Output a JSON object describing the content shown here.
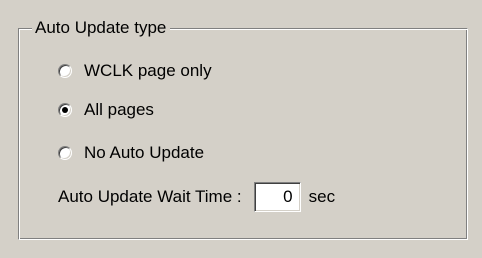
{
  "group": {
    "title": "Auto Update type"
  },
  "options": [
    {
      "label": "WCLK page only",
      "checked": false
    },
    {
      "label": "All pages",
      "checked": true
    },
    {
      "label": "No Auto Update",
      "checked": false
    }
  ],
  "wait_time": {
    "label": "Auto Update Wait Time :",
    "value": "0",
    "unit": "sec"
  }
}
